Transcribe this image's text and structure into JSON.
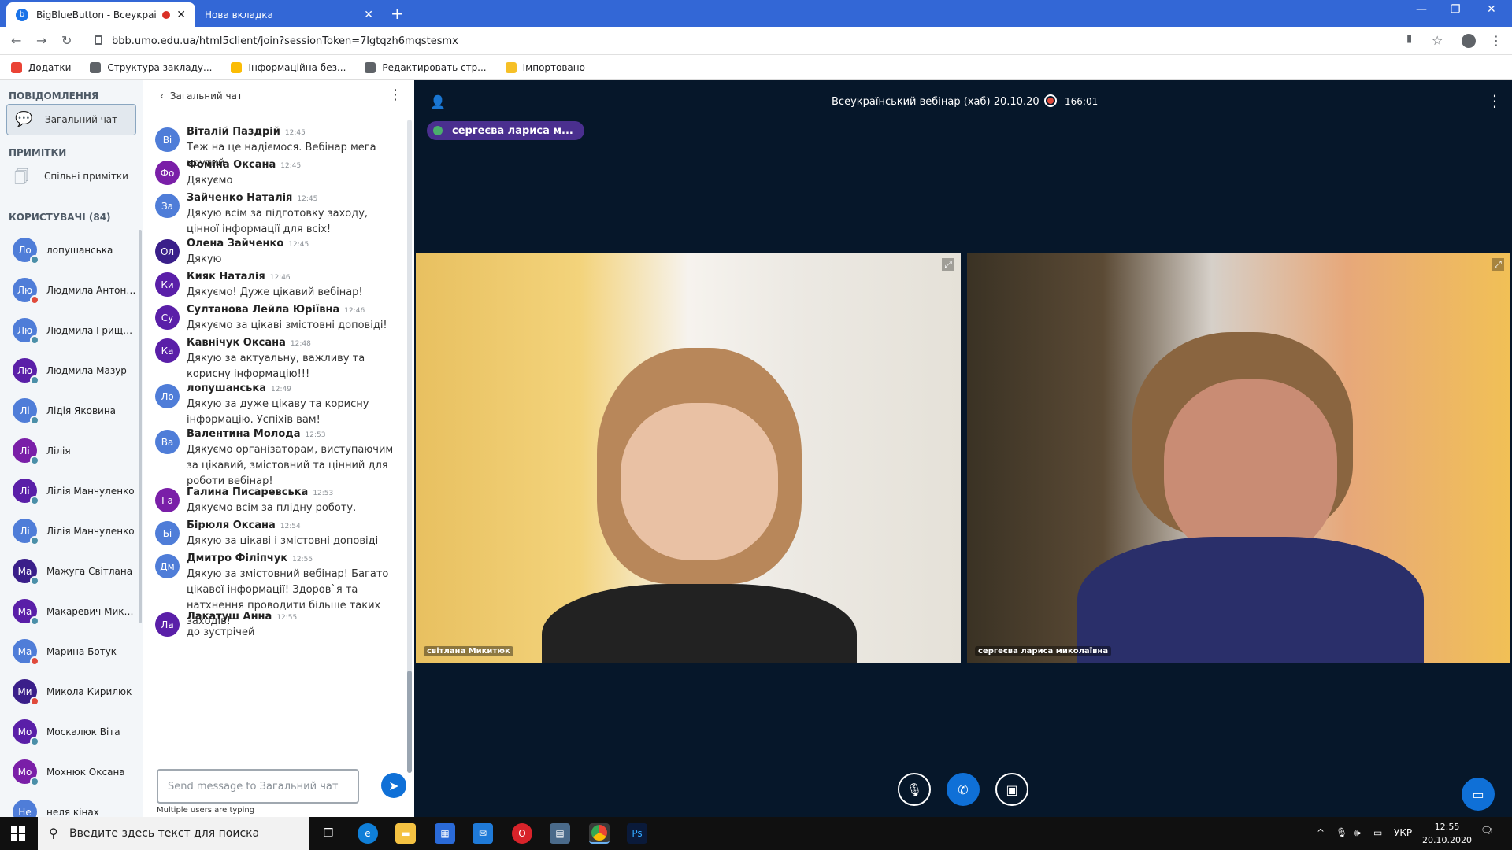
{
  "browser": {
    "tabs": [
      {
        "title": "BigBlueButton - Всеукраїнсь"
      },
      {
        "title": "Нова вкладка"
      }
    ],
    "url": "bbb.umo.edu.ua/html5client/join?sessionToken=7lgtqzh6mqstesmx",
    "bookmarks": [
      {
        "label": "Додатки",
        "color": "#ea4335"
      },
      {
        "label": "Структура закладу...",
        "color": "#5f6368"
      },
      {
        "label": "Інформаційна без...",
        "color": "#fbbc05"
      },
      {
        "label": "Редактировать стр...",
        "color": "#5f6368"
      },
      {
        "label": "Імпортовано",
        "color": "#f6c026"
      }
    ]
  },
  "sidebar": {
    "messages_heading": "ПОВІДОМЛЕННЯ",
    "public_chat": "Загальний чат",
    "notes_heading": "ПРИМІТКИ",
    "shared_notes": "Спільні примітки",
    "users_heading": "КОРИСТУВАЧІ (84)",
    "users": [
      {
        "initials": "Ло",
        "name": "лопушанська",
        "color": "#4f7dd8",
        "status": "#4a8fa8"
      },
      {
        "initials": "Лю",
        "name": "Людмила Антонюк",
        "color": "#4f7dd8",
        "status": "#e04a3b"
      },
      {
        "initials": "Лю",
        "name": "Людмила Грищенко",
        "color": "#4f7dd8",
        "status": "#4a8fa8"
      },
      {
        "initials": "Лю",
        "name": "Людмила Мазур",
        "color": "#5a1fa8",
        "status": "#4a8fa8"
      },
      {
        "initials": "Лі",
        "name": "Лідія Яковина",
        "color": "#4f7dd8",
        "status": "#4a8fa8"
      },
      {
        "initials": "Лі",
        "name": "Лілія",
        "color": "#7a1fa8",
        "status": "#4a8fa8"
      },
      {
        "initials": "Лі",
        "name": "Лілія Манчуленко",
        "color": "#5a1fa8",
        "status": "#4a8fa8"
      },
      {
        "initials": "Лі",
        "name": "Лілія Манчуленко",
        "color": "#4f7dd8",
        "status": "#4a8fa8"
      },
      {
        "initials": "Ма",
        "name": "Мажуга Світлана",
        "color": "#3a1f8a",
        "status": "#4a8fa8"
      },
      {
        "initials": "Ма",
        "name": "Макаревич Микола",
        "color": "#5a1fa8",
        "status": "#4a8fa8"
      },
      {
        "initials": "Ма",
        "name": "Марина Ботук",
        "color": "#4f7dd8",
        "status": "#e04a3b"
      },
      {
        "initials": "Ми",
        "name": "Микола Кирилюк",
        "color": "#3a1f8a",
        "status": "#e04a3b"
      },
      {
        "initials": "Мо",
        "name": "Москалюк Віта",
        "color": "#5a1fa8",
        "status": "#4a8fa8"
      },
      {
        "initials": "Мо",
        "name": "Мохнюк Оксана",
        "color": "#7a1fa8",
        "status": "#4a8fa8"
      },
      {
        "initials": "Не",
        "name": "неля кінах",
        "color": "#4f7dd8",
        "status": "#e04a3b"
      }
    ]
  },
  "chat": {
    "title": "Загальний чат",
    "placeholder": "Send message to Загальний чат",
    "typing": "Multiple users are typing",
    "messages": [
      {
        "initials": "Ві",
        "name": "Віталій Паздрій",
        "time": "12:45",
        "text": "Теж на це надіємося. Вебінар мега крутий",
        "color": "#4f7dd8"
      },
      {
        "initials": "Фо",
        "name": "Фоміна Оксана",
        "time": "12:45",
        "text": "Дякуємо",
        "color": "#7a1fa8"
      },
      {
        "initials": "За",
        "name": "Зайченко Наталія",
        "time": "12:45",
        "text": "Дякую всім за підготовку заходу, цінної інформації для всіх!",
        "color": "#4f7dd8"
      },
      {
        "initials": "Ол",
        "name": "Олена Зайченко",
        "time": "12:45",
        "text": "Дякую",
        "color": "#3a1f8a"
      },
      {
        "initials": "Ки",
        "name": "Кияк Наталія",
        "time": "12:46",
        "text": "Дякуємо! Дуже цікавий вебінар!",
        "color": "#5a1fa8"
      },
      {
        "initials": "Су",
        "name": "Султанова Лейла Юріївна",
        "time": "12:46",
        "text": "Дякуємо за цікаві змістовні доповіді!",
        "color": "#5a1fa8"
      },
      {
        "initials": "Ка",
        "name": "Кавнічук Оксана",
        "time": "12:48",
        "text": "Дякую за актуальну, важливу та корисну інформацію!!!",
        "color": "#5a1fa8"
      },
      {
        "initials": "Ло",
        "name": "лопушанська",
        "time": "12:49",
        "text": "Дякую за дуже цікаву та корисну інформацію. Успіхів вам!",
        "color": "#4f7dd8"
      },
      {
        "initials": "Ва",
        "name": "Валентина Молода",
        "time": "12:53",
        "text": "Дякуємо організаторам, виступаючим за цікавий, змістовний та цінний для роботи вебінар!",
        "color": "#4f7dd8"
      },
      {
        "initials": "Га",
        "name": "Галина Писаревська",
        "time": "12:53",
        "text": "Дякуємо всім за плідну роботу.",
        "color": "#7a1fa8"
      },
      {
        "initials": "Бі",
        "name": "Бірюля Оксана",
        "time": "12:54",
        "text": "Дякую за цікаві і змістовні доповіді",
        "color": "#4f7dd8"
      },
      {
        "initials": "Дм",
        "name": "Дмитро Філіпчук",
        "time": "12:55",
        "text": "Дякую за змістовний вебінар! Багато цікавої інформації! Здоров`я та натхнення проводити більше таких заходів!",
        "color": "#4f7dd8"
      },
      {
        "initials": "Ла",
        "name": "Лакатуш Анна",
        "time": "12:55",
        "text": "до зустрічей",
        "color": "#5a1fa8"
      }
    ]
  },
  "meeting": {
    "title": "Всеукраїнський вебінар (хаб) 20.10.20",
    "rec_time": "166:01",
    "talking": "сергеєва лариса м...",
    "video1_name": "світлана Микитюк",
    "video2_name": "сергеєва лариса миколаївна"
  },
  "taskbar": {
    "search": "Введите здесь текст для поиска",
    "lang": "УКР",
    "time": "12:55",
    "date": "20.10.2020",
    "ps": "Ps",
    "notif": "1"
  }
}
